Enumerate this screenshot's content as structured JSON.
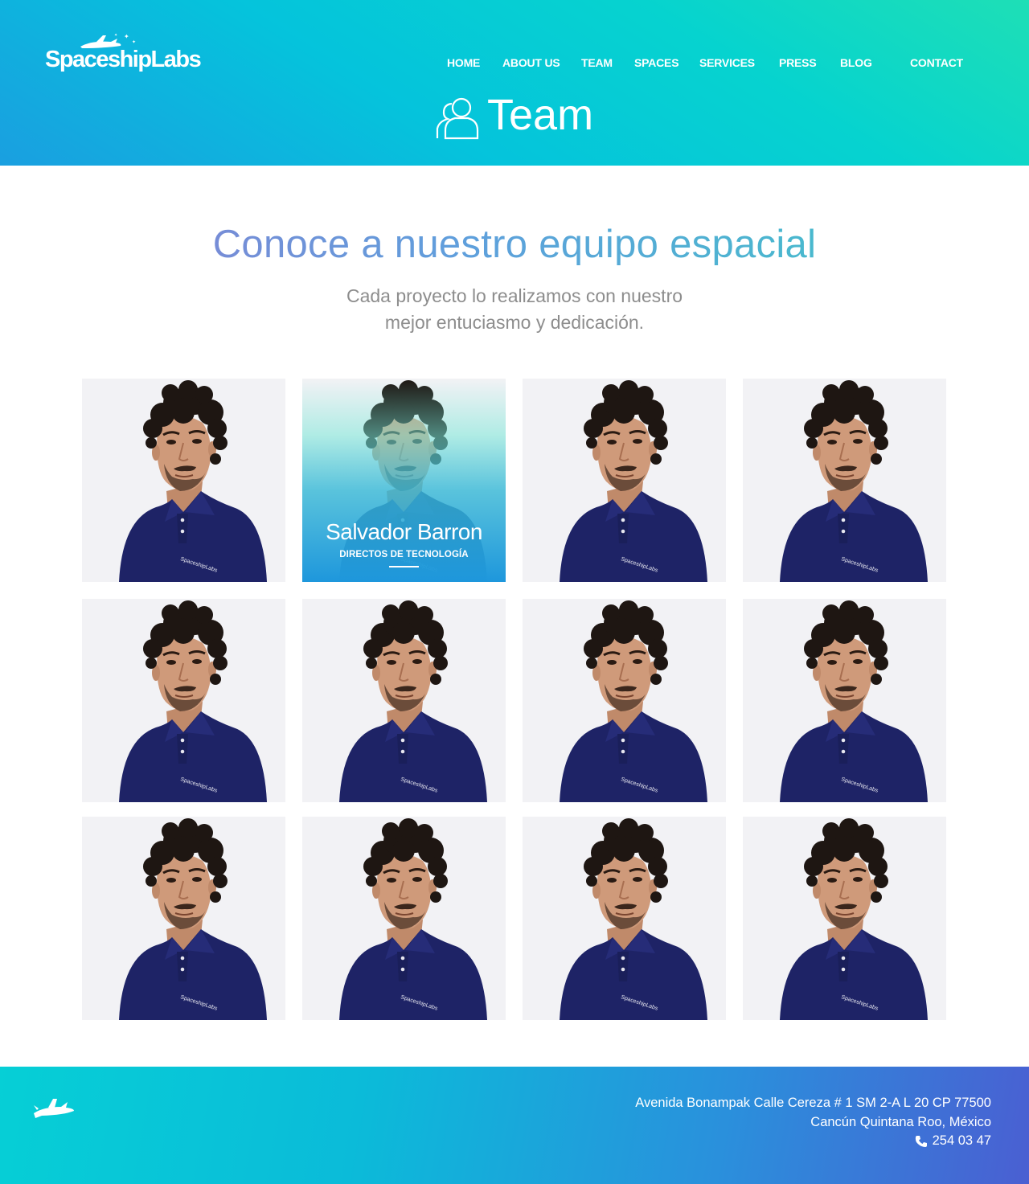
{
  "brand": {
    "logo_text": "SpaceshipLabs"
  },
  "nav": {
    "items": [
      {
        "label": "HOME"
      },
      {
        "label": "ABOUT US"
      },
      {
        "label": "TEAM"
      },
      {
        "label": "SPACES"
      },
      {
        "label": "SERVICES"
      },
      {
        "label": "PRESS"
      },
      {
        "label": "BLOG"
      },
      {
        "label": "CONTACT"
      }
    ]
  },
  "page": {
    "title": "Team",
    "icon": "people-icon"
  },
  "intro": {
    "heading": "Conoce a nuestro equipo espacial",
    "subtitle_line1": "Cada proyecto lo realizamos con nuestro",
    "subtitle_line2": "mejor entuciasmo y dedicación."
  },
  "team": {
    "featured": {
      "name": "Salvador Barron",
      "role": "DIRECTOS DE TECNOLOGÍA"
    },
    "member_count": 12,
    "shirt_logo": "SpaceshipLabs"
  },
  "footer": {
    "address_line1": "Avenida Bonampak Calle Cereza # 1 SM 2-A L 20 CP 77500",
    "address_line2": "Cancún Quintana Roo, México",
    "phone": "254 03 47",
    "icons": [
      "spaceship-icon",
      "phone-icon"
    ]
  },
  "colors": {
    "header_gradient": [
      "#1a9fe0",
      "#05c3dc",
      "#1edfb6"
    ],
    "footer_gradient": [
      "#06cfd6",
      "#2a90dc",
      "#4a5fd2"
    ],
    "shirt": "#1e2366",
    "text_grey": "#8d8d8d"
  }
}
